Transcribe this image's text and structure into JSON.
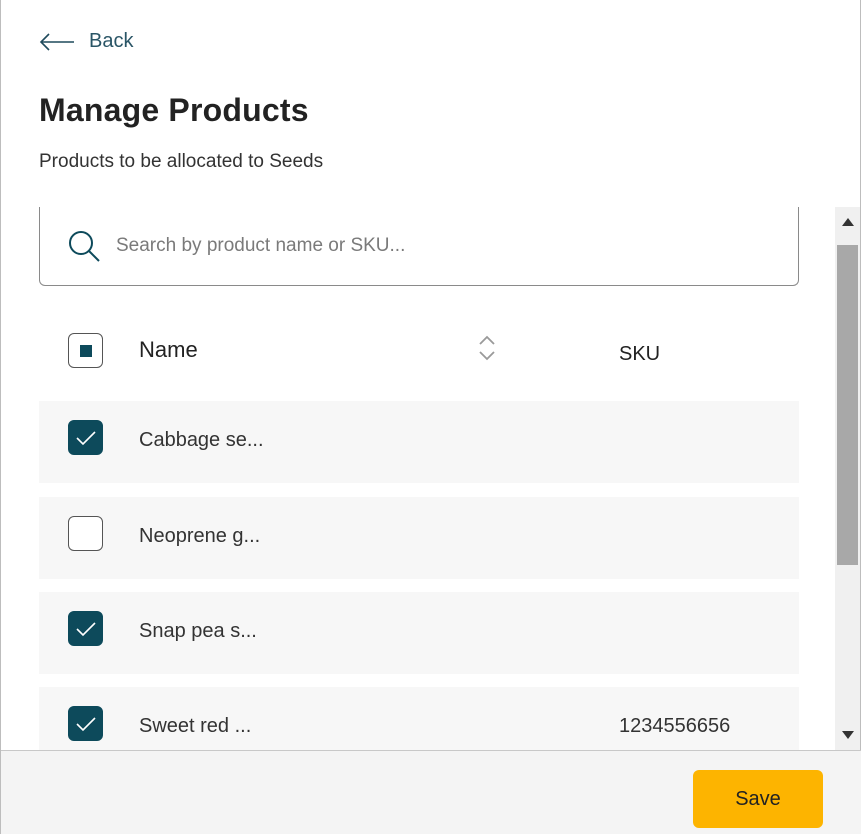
{
  "nav": {
    "back_label": "Back"
  },
  "page": {
    "title": "Manage Products",
    "subtitle": "Products to be allocated to Seeds"
  },
  "search": {
    "placeholder": "Search by product name or SKU...",
    "value": ""
  },
  "table": {
    "header": {
      "select_all_state": "indeterminate",
      "name": "Name",
      "sku": "SKU"
    },
    "rows": [
      {
        "checked": true,
        "name": "Cabbage se...",
        "sku": ""
      },
      {
        "checked": false,
        "name": "Neoprene g...",
        "sku": ""
      },
      {
        "checked": true,
        "name": "Snap pea s...",
        "sku": ""
      },
      {
        "checked": true,
        "name": "Sweet red ...",
        "sku": "1234556656"
      }
    ]
  },
  "footer": {
    "save_label": "Save"
  },
  "colors": {
    "accent": "#0d4a5b",
    "save_button": "#fdb400",
    "row_background": "#f7f7f7"
  },
  "icons": {
    "back": "arrow-left-icon",
    "search": "search-icon",
    "sort": "sort-icon",
    "check": "checkmark-icon"
  }
}
